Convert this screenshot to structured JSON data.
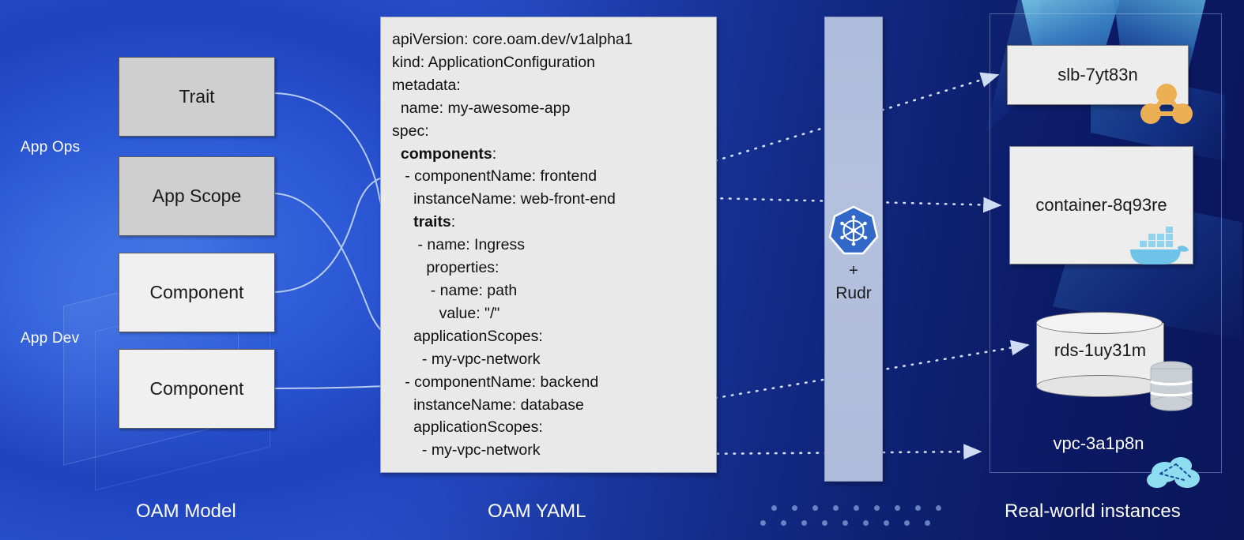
{
  "diagram": {
    "title_bottom_captions": {
      "model": "OAM Model",
      "yaml": "OAM YAML",
      "real": "Real-world instances"
    },
    "colors": {
      "bg_blue_light": "#2b53cf",
      "bg_blue_dark": "#0a1659",
      "model_box_gray": "#cfcfcf",
      "model_box_white": "#f0f0f0",
      "yaml_panel": "#e9e9e9",
      "rudr_column": "#aebcdc",
      "k8s_blue": "#3269c8",
      "slb_icon_orange": "#edaf54",
      "docker_blue": "#6fc3e8",
      "connector_line": "#c3d6f2",
      "dotted_arrow": "#dce7fa"
    }
  },
  "left_panel": {
    "role_labels": [
      {
        "id": "app-ops",
        "text": "App Ops"
      },
      {
        "id": "app-dev",
        "text": "App Dev"
      }
    ],
    "boxes": [
      {
        "id": "trait",
        "label": "Trait",
        "fill": "gray"
      },
      {
        "id": "app-scope",
        "label": "App Scope",
        "fill": "gray"
      },
      {
        "id": "component-1",
        "label": "Component",
        "fill": "white"
      },
      {
        "id": "component-2",
        "label": "Component",
        "fill": "white"
      }
    ]
  },
  "yaml_panel": {
    "lines": [
      "apiVersion: core.oam.dev/v1alpha1",
      "kind: ApplicationConfiguration",
      "metadata:",
      "  name: my-awesome-app",
      "spec:",
      "  components:",
      "   - componentName: frontend",
      "     instanceName: web-front-end",
      "     traits:",
      "      - name: Ingress",
      "        properties:",
      "         - name: path",
      "           value: \"/\"",
      "     applicationScopes:",
      "       - my-vpc-network",
      "   - componentName: backend",
      "     instanceName: database",
      "     applicationScopes:",
      "       - my-vpc-network"
    ],
    "bold_tokens": [
      "components",
      "traits"
    ]
  },
  "runtime_column": {
    "icon": "kubernetes-logo",
    "plus": "+",
    "name": "Rudr"
  },
  "right_panel": {
    "instances": [
      {
        "id": "slb",
        "label": "slb-7yt83n",
        "icon": "load-balancer-icon",
        "shape": "rect"
      },
      {
        "id": "container",
        "label": "container-8q93re",
        "icon": "docker-whale-icon",
        "shape": "rect"
      },
      {
        "id": "rds",
        "label": "rds-1uy31m",
        "icon": "database-stack-icon",
        "shape": "cylinder"
      },
      {
        "id": "vpc",
        "label": "vpc-3a1p8n",
        "icon": "cloud-network-icon",
        "shape": "text"
      }
    ]
  }
}
